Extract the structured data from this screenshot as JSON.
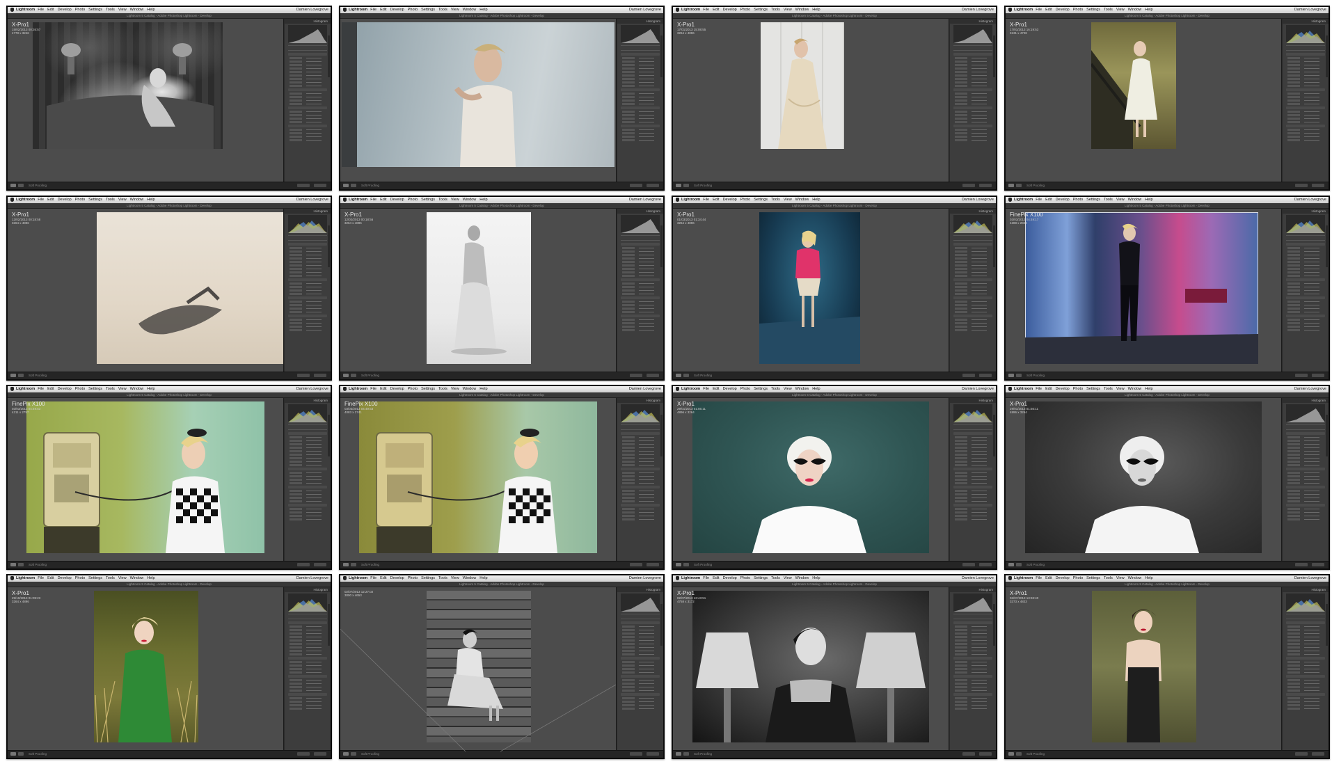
{
  "menubar": {
    "app": "Lightroom",
    "menus": [
      "File",
      "Edit",
      "Develop",
      "Photo",
      "Settings",
      "Tools",
      "View",
      "Window",
      "Help"
    ],
    "clock": "Damien Lovegrove"
  },
  "window_title": "Lightroom 5 Catalog - Adobe Photoshop Lightroom - Develop",
  "panel": {
    "histogram_label": "Histogram"
  },
  "footer": {
    "soft_proofing": "Soft Proofing"
  },
  "colors": {
    "stage": "#4c4c4c",
    "panel": "#3d3d3d",
    "menubar": "#dcdcdc"
  },
  "thumbnails": [
    {
      "camera": "X-Pro1",
      "datetime": "15/02/2013 00:26:57",
      "dimensions": "4778 x 3246",
      "subject": "monochrome boudoir on ornate bed",
      "hist": "mono"
    },
    {
      "camera": "",
      "datetime": "",
      "dimensions": "",
      "subject": "bride in corset against pale sky",
      "hist": "mono"
    },
    {
      "camera": "X-Pro1",
      "datetime": "17/01/2013 15:08:55",
      "dimensions": "3264 x 4896",
      "subject": "bride in satin gown by white panelled wall",
      "hist": "mono"
    },
    {
      "camera": "X-Pro1",
      "datetime": "17/01/2013 16:19:53",
      "dimensions": "3131 x 4728",
      "subject": "woman in gown on staircase",
      "hist": "color"
    },
    {
      "camera": "X-Pro1",
      "datetime": "12/02/2013 00:18:58",
      "dimensions": "3264 x 4896",
      "subject": "sand dune with shadow",
      "hist": "color"
    },
    {
      "camera": "X-Pro1",
      "datetime": "12/02/2013 00:18:56",
      "dimensions": "3264 x 4896",
      "subject": "woman in white dress on sand",
      "hist": "mono"
    },
    {
      "camera": "X-Pro1",
      "datetime": "01/03/2013 01:34:44",
      "dimensions": "3264 x 4896",
      "subject": "woman in pink jacket on cobbles at night",
      "hist": "color"
    },
    {
      "camera": "FinePix X100",
      "datetime": "03/03/2013 04:49:17",
      "dimensions": "4288 x 2848",
      "subject": "woman in leather in neon hall",
      "hist": "color"
    },
    {
      "camera": "FinePix X100",
      "datetime": "03/03/2013 04:49:53",
      "dimensions": "4211 x 2797",
      "subject": "woman on payphone, green wall",
      "hist": "color"
    },
    {
      "camera": "FinePix X100",
      "datetime": "03/03/2013 04:49:53",
      "dimensions": "4083 x 2741",
      "subject": "woman on payphone, warm tones",
      "hist": "color"
    },
    {
      "camera": "X-Pro1",
      "datetime": "29/01/2013 01:56:11",
      "dimensions": "4896 x 3264",
      "subject": "platinum blonde in cat-eye sunglasses, teal backdrop",
      "hist": "color"
    },
    {
      "camera": "X-Pro1",
      "datetime": "29/01/2013 01:56:11",
      "dimensions": "4896 x 3264",
      "subject": "platinum blonde in sunglasses, monochrome",
      "hist": "mono"
    },
    {
      "camera": "X-Pro1",
      "datetime": "29/10/2013 01:09:23",
      "dimensions": "3264 x 4896",
      "subject": "blonde in green coat among grasses",
      "hist": "color"
    },
    {
      "camera": "",
      "datetime": "02/07/2013 12:27:02",
      "dimensions": "3000 x 4653",
      "subject": "woman seated on stairs, monochrome",
      "hist": "mono"
    },
    {
      "camera": "X-Pro1",
      "datetime": "02/07/2013 13:43:51",
      "dimensions": "4758 x 3172",
      "subject": "woman between lamps, monochrome",
      "hist": "mono"
    },
    {
      "camera": "X-Pro1",
      "datetime": "02/07/2013 13:33:40",
      "dimensions": "3373 x 4823",
      "subject": "woman in corset, green room",
      "hist": "color"
    }
  ]
}
